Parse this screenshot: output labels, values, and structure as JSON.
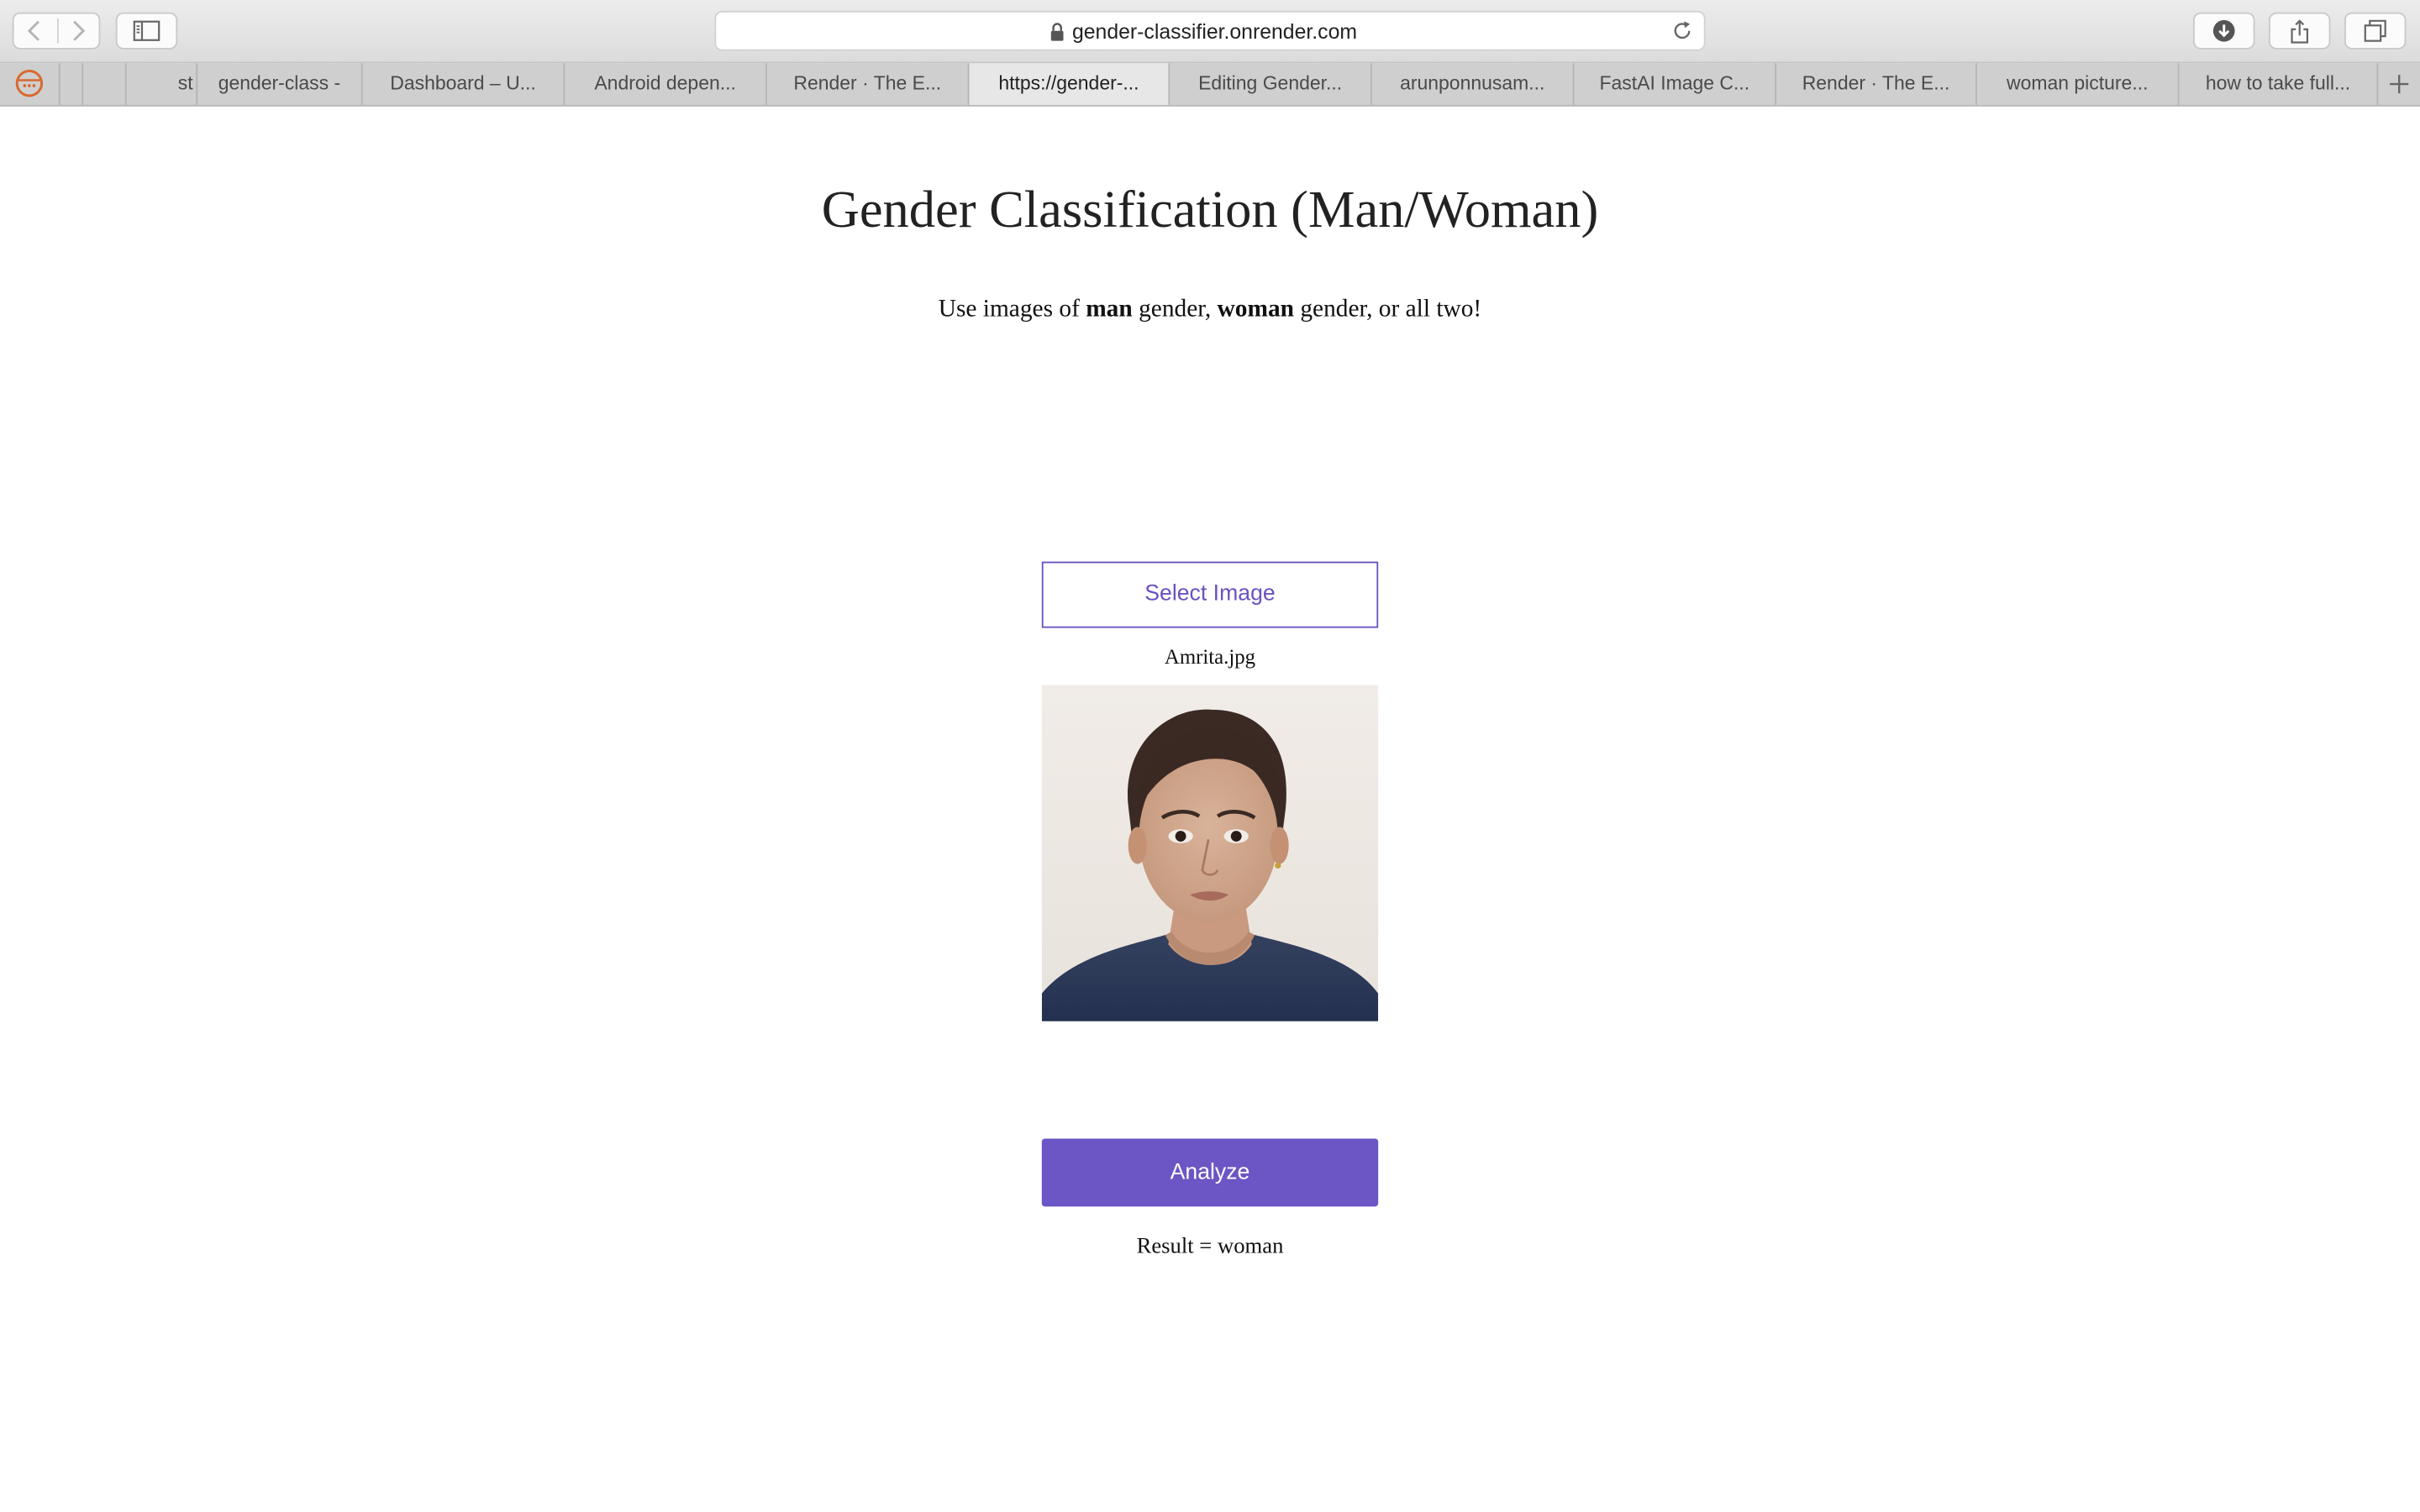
{
  "browser": {
    "url": "gender-classifier.onrender.com",
    "tabs": [
      {
        "label": "st",
        "active": false
      },
      {
        "label": "gender-class -",
        "active": false
      },
      {
        "label": "Dashboard – U...",
        "active": false
      },
      {
        "label": "Android depen...",
        "active": false
      },
      {
        "label": "Render · The E...",
        "active": false
      },
      {
        "label": "https://gender-...",
        "active": true
      },
      {
        "label": "Editing Gender...",
        "active": false
      },
      {
        "label": "arunponnusam...",
        "active": false
      },
      {
        "label": "FastAI Image C...",
        "active": false
      },
      {
        "label": "Render · The E...",
        "active": false
      },
      {
        "label": "woman picture...",
        "active": false
      },
      {
        "label": "how to take full...",
        "active": false
      }
    ]
  },
  "page": {
    "title": "Gender Classification (Man/Woman)",
    "subtitle": {
      "prefix": "Use images of ",
      "bold1": "man",
      "mid1": " gender, ",
      "bold2": "woman",
      "suffix": " gender, or all two!"
    },
    "select_button": "Select Image",
    "filename": "Amrita.jpg",
    "analyze_button": "Analyze",
    "result": "Result = woman"
  },
  "colors": {
    "accent": "#6c55c4",
    "toolbar": "#dcdcdc",
    "active_tab": "#e7e7e7"
  },
  "icons": {
    "back": "chevron-left-icon",
    "forward": "chevron-right-icon",
    "sidebar": "sidebar-icon",
    "lock": "lock-icon",
    "reload": "reload-icon",
    "download": "download-icon",
    "share": "share-icon",
    "tabs": "tabs-overview-icon",
    "new_tab": "plus-icon",
    "pinned": "pinned-site-icon"
  }
}
